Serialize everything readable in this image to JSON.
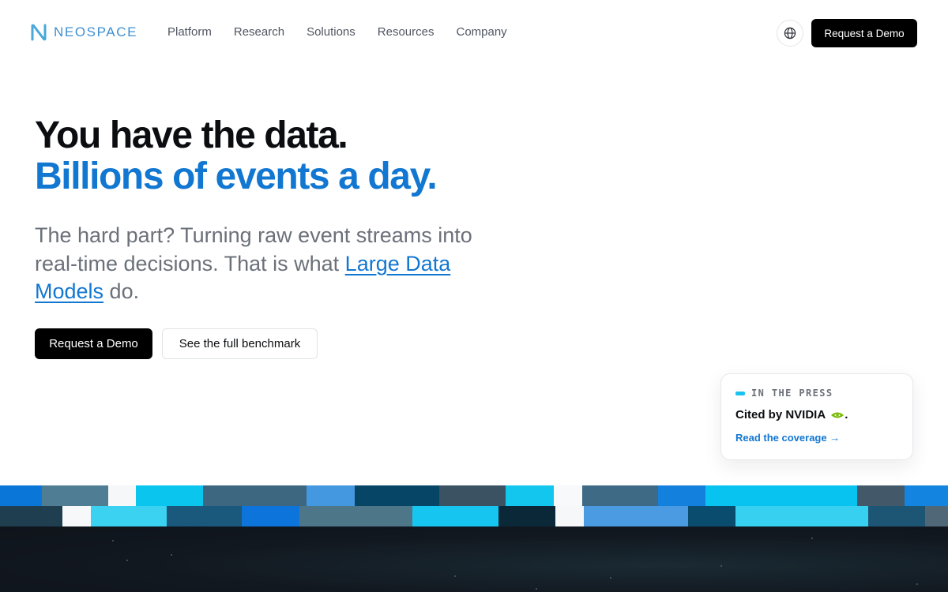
{
  "brand": {
    "name": "NEOSPACE",
    "color": "#3e8fd0"
  },
  "nav": {
    "items": [
      {
        "label": "Platform"
      },
      {
        "label": "Research"
      },
      {
        "label": "Solutions"
      },
      {
        "label": "Resources"
      },
      {
        "label": "Company"
      }
    ],
    "globe_icon": "globe-icon",
    "cta_label": "Request a Demo"
  },
  "hero": {
    "title_line1": "You have the data.",
    "title_line2": "Billions of events a day.",
    "subtitle_prefix": "The hard part? Turning raw event streams into real-time decisions. That is what ",
    "subtitle_link": "Large Data Models",
    "subtitle_suffix": " do.",
    "primary_cta": "Request a Demo",
    "secondary_cta": "See the full benchmark"
  },
  "press": {
    "eyebrow": "IN THE PRESS",
    "cited_text": "Cited by NVIDIA",
    "cited_suffix": ".",
    "nvidia_icon": "nvidia-logo-icon",
    "link_label": "Read the coverage →"
  },
  "colors": {
    "accent": "#1277d1",
    "cyan": "#19c3f0",
    "dark_bg": "#121820"
  }
}
